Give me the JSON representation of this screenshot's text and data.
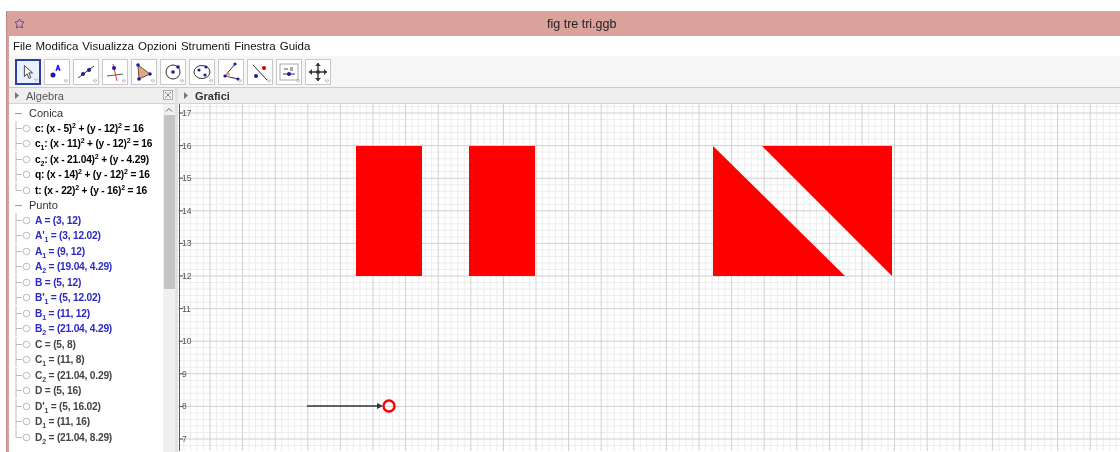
{
  "window": {
    "title": "fig tre tri.ggb"
  },
  "menu": [
    "File",
    "Modifica",
    "Visualizza",
    "Opzioni",
    "Strumenti",
    "Finestra",
    "Guida"
  ],
  "toolbar": [
    {
      "kind": "move",
      "selected": true
    },
    {
      "kind": "point",
      "selected": false
    },
    {
      "kind": "line",
      "selected": false
    },
    {
      "kind": "perpendicular",
      "selected": false
    },
    {
      "kind": "polygon",
      "selected": false
    },
    {
      "kind": "circle",
      "selected": false
    },
    {
      "kind": "conic",
      "selected": false
    },
    {
      "kind": "angle",
      "selected": false
    },
    {
      "kind": "reflect",
      "selected": false
    },
    {
      "kind": "slider",
      "selected": false
    },
    {
      "kind": "move-view",
      "selected": false
    }
  ],
  "algebra": {
    "title": "Algebra",
    "groups": [
      {
        "label": "Conica",
        "expanded": true,
        "items": [
          {
            "text": "c: (x - 5)$^{2}$ + (y - 12)$^{2}$ = 16",
            "color": "#000000"
          },
          {
            "text": "c$_{1}$: (x - 11)$^{2}$ + (y - 12)$^{2}$ = 16",
            "color": "#000000"
          },
          {
            "text": "c$_{2}$: (x - 21.04)$^{2}$ + (y - 4.29)",
            "color": "#000000"
          },
          {
            "text": "q: (x - 14)$^{2}$ + (y - 12)$^{2}$ = 16",
            "color": "#000000"
          },
          {
            "text": "t: (x - 22)$^{2}$ + (y - 16)$^{2}$ = 16",
            "color": "#000000"
          }
        ]
      },
      {
        "label": "Punto",
        "expanded": true,
        "items": [
          {
            "text": "A = (3, 12)",
            "color": "#2929c4"
          },
          {
            "text": "A'$_{1}$ = (3, 12.02)",
            "color": "#2929c4"
          },
          {
            "text": "A$_{1}$ = (9, 12)",
            "color": "#2929c4"
          },
          {
            "text": "A$_{2}$ = (19.04, 4.29)",
            "color": "#2929c4"
          },
          {
            "text": "B = (5, 12)",
            "color": "#2929c4"
          },
          {
            "text": "B'$_{1}$ = (5, 12.02)",
            "color": "#2929c4"
          },
          {
            "text": "B$_{1}$ = (11, 12)",
            "color": "#2929c4"
          },
          {
            "text": "B$_{2}$ = (21.04, 4.29)",
            "color": "#2929c4"
          },
          {
            "text": "C = (5, 8)",
            "color": "#444444"
          },
          {
            "text": "C$_{1}$ = (11, 8)",
            "color": "#444444"
          },
          {
            "text": "C$_{2}$ = (21.04, 0.29)",
            "color": "#444444"
          },
          {
            "text": "D = (5, 16)",
            "color": "#444444"
          },
          {
            "text": "D'$_{1}$ = (5, 16.02)",
            "color": "#444444"
          },
          {
            "text": "D$_{1}$ = (11, 16)",
            "color": "#444444"
          },
          {
            "text": "D$_{2}$ = (21.04, 8.29)",
            "color": "#444444"
          }
        ]
      }
    ]
  },
  "graphics": {
    "title": "Grafici",
    "y_labels": [
      "17",
      "16",
      "15",
      "14",
      "13",
      "12",
      "11",
      "10",
      "9",
      "8",
      "7"
    ]
  }
}
